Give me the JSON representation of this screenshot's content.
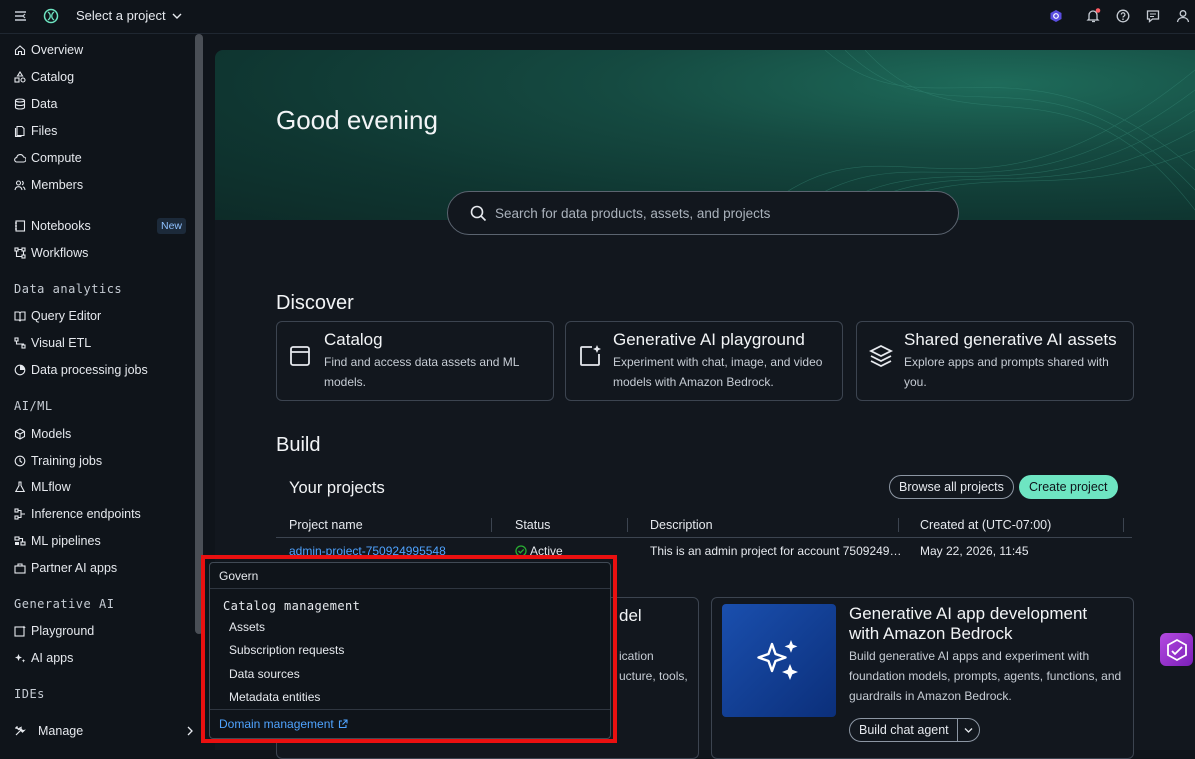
{
  "topbar": {
    "project_selector": "Select a project"
  },
  "sidebar": {
    "items_top": [
      {
        "label": "Overview",
        "icon": "home-icon"
      },
      {
        "label": "Catalog",
        "icon": "shapes-icon"
      },
      {
        "label": "Data",
        "icon": "database-icon"
      },
      {
        "label": "Files",
        "icon": "files-icon"
      },
      {
        "label": "Compute",
        "icon": "cloud-icon"
      },
      {
        "label": "Members",
        "icon": "members-icon"
      }
    ],
    "notebooks": "Notebooks",
    "notebooks_badge": "New",
    "workflows": "Workflows",
    "data_analytics_heading": "Data analytics",
    "data_analytics": [
      "Query Editor",
      "Visual ETL",
      "Data processing jobs"
    ],
    "aiml_heading": "AI/ML",
    "aiml": [
      "Models",
      "Training jobs",
      "MLflow",
      "Inference endpoints",
      "ML pipelines",
      "Partner AI apps"
    ],
    "genai_heading": "Generative AI",
    "genai": [
      "Playground",
      "AI apps"
    ],
    "ides_heading": "IDEs",
    "manage": "Manage"
  },
  "hero": {
    "greeting": "Good evening",
    "search_placeholder": "Search for data products, assets, and projects"
  },
  "discover": {
    "title": "Discover",
    "cards": [
      {
        "title": "Catalog",
        "desc": "Find and access data assets and ML models."
      },
      {
        "title": "Generative AI playground",
        "desc": "Experiment with chat, image, and video models with Amazon Bedrock."
      },
      {
        "title": "Shared generative AI assets",
        "desc": "Explore apps and prompts shared with you."
      }
    ]
  },
  "build": {
    "title": "Build",
    "your_projects": "Your projects",
    "browse_all": "Browse all projects",
    "create_project": "Create project",
    "columns": [
      "Project name",
      "Status",
      "Description",
      "Created at (UTC-07:00)"
    ],
    "rows": [
      {
        "name": "admin-project-750924995548",
        "status": "Active",
        "description": "This is an admin project for account 7509249…",
        "created": "May 22, 2026, 11:45"
      }
    ],
    "left_card_partial": {
      "title": "del",
      "desc": [
        "ication",
        "ucture, tools,"
      ]
    },
    "right_card": {
      "title": "Generative AI app development with Amazon Bedrock",
      "desc": "Build generative AI apps and experiment with foundation models, prompts, agents, functions, and guardrails in Amazon Bedrock.",
      "button": "Build chat agent"
    }
  },
  "popup": {
    "heading": "Govern",
    "section": "Catalog management",
    "items": [
      "Assets",
      "Subscription requests",
      "Data sources",
      "Metadata entities"
    ],
    "link": "Domain management"
  },
  "colors": {
    "accent": "#6ee5c2",
    "link": "#4fa3ff",
    "highlight": "#ea1010"
  }
}
